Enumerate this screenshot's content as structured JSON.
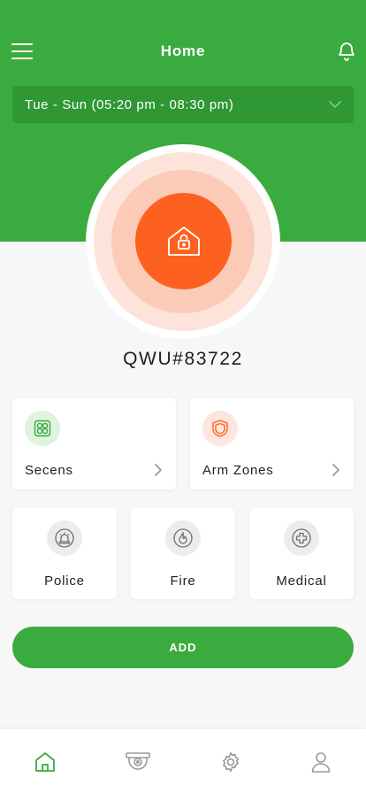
{
  "header": {
    "title": "Home",
    "menu_icon": "hamburger-menu-icon",
    "notification_icon": "bell-icon",
    "background_color": "#3aab3e"
  },
  "schedule": {
    "value": "Tue - Sun (05:20 pm - 08:30 pm)",
    "icon": "chevron-down-icon"
  },
  "arm_button": {
    "icon": "house-lock-icon",
    "color": "#fd6120"
  },
  "device": {
    "id": "QWU#83722"
  },
  "quick_cards": [
    {
      "label": "Secens",
      "icon": "scenes-icon",
      "accent": "#3aab3e"
    },
    {
      "label": "Arm Zones",
      "icon": "shield-icon",
      "accent": "#fd6120"
    }
  ],
  "emergency_cards": [
    {
      "label": "Police",
      "icon": "police-siren-icon"
    },
    {
      "label": "Fire",
      "icon": "fire-icon"
    },
    {
      "label": "Medical",
      "icon": "medical-cross-icon"
    }
  ],
  "add_button": {
    "label": "ADD"
  },
  "tab_bar": {
    "items": [
      {
        "name": "home",
        "icon": "home-icon",
        "active": true
      },
      {
        "name": "camera",
        "icon": "camera-icon",
        "active": false
      },
      {
        "name": "settings",
        "icon": "gear-icon",
        "active": false
      },
      {
        "name": "profile",
        "icon": "user-icon",
        "active": false
      }
    ],
    "active_color": "#3aab3e",
    "inactive_color": "#9a9a9a"
  }
}
